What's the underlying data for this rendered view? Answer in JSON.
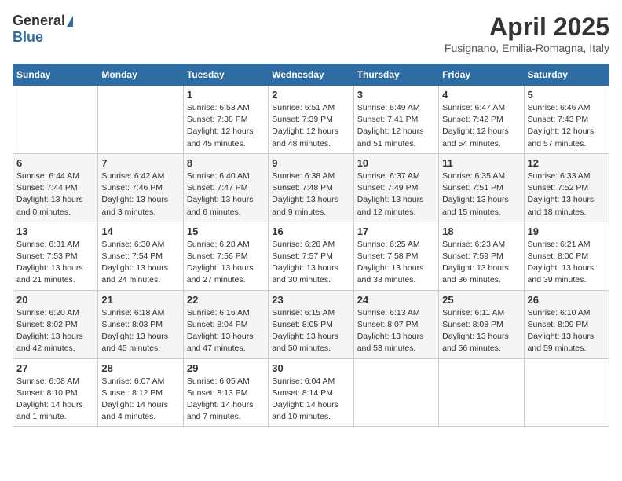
{
  "logo": {
    "general": "General",
    "blue": "Blue"
  },
  "title": {
    "month": "April 2025",
    "location": "Fusignano, Emilia-Romagna, Italy"
  },
  "weekdays": [
    "Sunday",
    "Monday",
    "Tuesday",
    "Wednesday",
    "Thursday",
    "Friday",
    "Saturday"
  ],
  "weeks": [
    [
      {
        "day": "",
        "detail": ""
      },
      {
        "day": "",
        "detail": ""
      },
      {
        "day": "1",
        "detail": "Sunrise: 6:53 AM\nSunset: 7:38 PM\nDaylight: 12 hours\nand 45 minutes."
      },
      {
        "day": "2",
        "detail": "Sunrise: 6:51 AM\nSunset: 7:39 PM\nDaylight: 12 hours\nand 48 minutes."
      },
      {
        "day": "3",
        "detail": "Sunrise: 6:49 AM\nSunset: 7:41 PM\nDaylight: 12 hours\nand 51 minutes."
      },
      {
        "day": "4",
        "detail": "Sunrise: 6:47 AM\nSunset: 7:42 PM\nDaylight: 12 hours\nand 54 minutes."
      },
      {
        "day": "5",
        "detail": "Sunrise: 6:46 AM\nSunset: 7:43 PM\nDaylight: 12 hours\nand 57 minutes."
      }
    ],
    [
      {
        "day": "6",
        "detail": "Sunrise: 6:44 AM\nSunset: 7:44 PM\nDaylight: 13 hours\nand 0 minutes."
      },
      {
        "day": "7",
        "detail": "Sunrise: 6:42 AM\nSunset: 7:46 PM\nDaylight: 13 hours\nand 3 minutes."
      },
      {
        "day": "8",
        "detail": "Sunrise: 6:40 AM\nSunset: 7:47 PM\nDaylight: 13 hours\nand 6 minutes."
      },
      {
        "day": "9",
        "detail": "Sunrise: 6:38 AM\nSunset: 7:48 PM\nDaylight: 13 hours\nand 9 minutes."
      },
      {
        "day": "10",
        "detail": "Sunrise: 6:37 AM\nSunset: 7:49 PM\nDaylight: 13 hours\nand 12 minutes."
      },
      {
        "day": "11",
        "detail": "Sunrise: 6:35 AM\nSunset: 7:51 PM\nDaylight: 13 hours\nand 15 minutes."
      },
      {
        "day": "12",
        "detail": "Sunrise: 6:33 AM\nSunset: 7:52 PM\nDaylight: 13 hours\nand 18 minutes."
      }
    ],
    [
      {
        "day": "13",
        "detail": "Sunrise: 6:31 AM\nSunset: 7:53 PM\nDaylight: 13 hours\nand 21 minutes."
      },
      {
        "day": "14",
        "detail": "Sunrise: 6:30 AM\nSunset: 7:54 PM\nDaylight: 13 hours\nand 24 minutes."
      },
      {
        "day": "15",
        "detail": "Sunrise: 6:28 AM\nSunset: 7:56 PM\nDaylight: 13 hours\nand 27 minutes."
      },
      {
        "day": "16",
        "detail": "Sunrise: 6:26 AM\nSunset: 7:57 PM\nDaylight: 13 hours\nand 30 minutes."
      },
      {
        "day": "17",
        "detail": "Sunrise: 6:25 AM\nSunset: 7:58 PM\nDaylight: 13 hours\nand 33 minutes."
      },
      {
        "day": "18",
        "detail": "Sunrise: 6:23 AM\nSunset: 7:59 PM\nDaylight: 13 hours\nand 36 minutes."
      },
      {
        "day": "19",
        "detail": "Sunrise: 6:21 AM\nSunset: 8:00 PM\nDaylight: 13 hours\nand 39 minutes."
      }
    ],
    [
      {
        "day": "20",
        "detail": "Sunrise: 6:20 AM\nSunset: 8:02 PM\nDaylight: 13 hours\nand 42 minutes."
      },
      {
        "day": "21",
        "detail": "Sunrise: 6:18 AM\nSunset: 8:03 PM\nDaylight: 13 hours\nand 45 minutes."
      },
      {
        "day": "22",
        "detail": "Sunrise: 6:16 AM\nSunset: 8:04 PM\nDaylight: 13 hours\nand 47 minutes."
      },
      {
        "day": "23",
        "detail": "Sunrise: 6:15 AM\nSunset: 8:05 PM\nDaylight: 13 hours\nand 50 minutes."
      },
      {
        "day": "24",
        "detail": "Sunrise: 6:13 AM\nSunset: 8:07 PM\nDaylight: 13 hours\nand 53 minutes."
      },
      {
        "day": "25",
        "detail": "Sunrise: 6:11 AM\nSunset: 8:08 PM\nDaylight: 13 hours\nand 56 minutes."
      },
      {
        "day": "26",
        "detail": "Sunrise: 6:10 AM\nSunset: 8:09 PM\nDaylight: 13 hours\nand 59 minutes."
      }
    ],
    [
      {
        "day": "27",
        "detail": "Sunrise: 6:08 AM\nSunset: 8:10 PM\nDaylight: 14 hours\nand 1 minute."
      },
      {
        "day": "28",
        "detail": "Sunrise: 6:07 AM\nSunset: 8:12 PM\nDaylight: 14 hours\nand 4 minutes."
      },
      {
        "day": "29",
        "detail": "Sunrise: 6:05 AM\nSunset: 8:13 PM\nDaylight: 14 hours\nand 7 minutes."
      },
      {
        "day": "30",
        "detail": "Sunrise: 6:04 AM\nSunset: 8:14 PM\nDaylight: 14 hours\nand 10 minutes."
      },
      {
        "day": "",
        "detail": ""
      },
      {
        "day": "",
        "detail": ""
      },
      {
        "day": "",
        "detail": ""
      }
    ]
  ]
}
